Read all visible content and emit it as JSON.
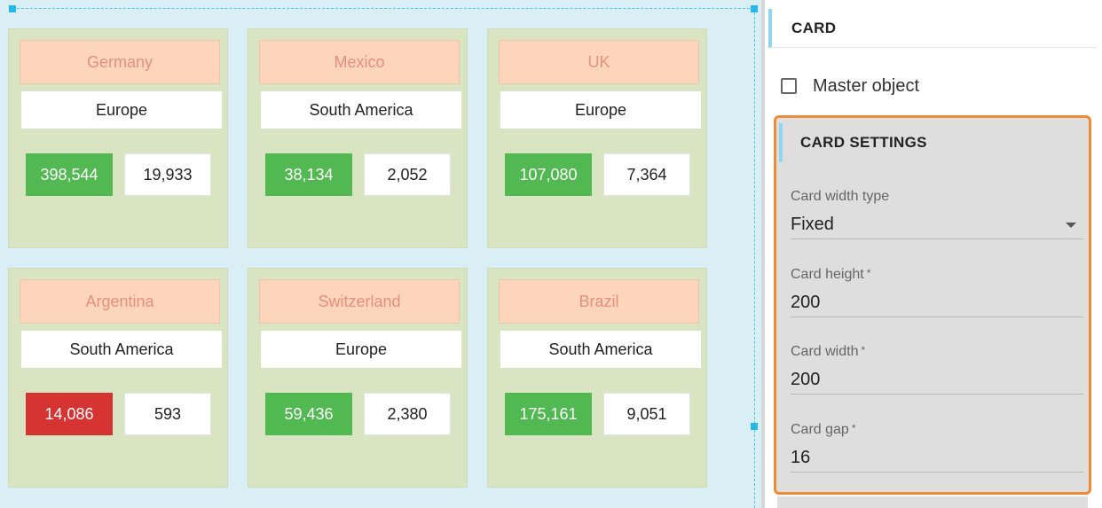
{
  "cards": [
    {
      "country": "Germany",
      "region": "Europe",
      "primary": "398,544",
      "secondary": "19,933",
      "primary_color": "#52b852"
    },
    {
      "country": "Mexico",
      "region": "South America",
      "primary": "38,134",
      "secondary": "2,052",
      "primary_color": "#52b852"
    },
    {
      "country": "UK",
      "region": "Europe",
      "primary": "107,080",
      "secondary": "7,364",
      "primary_color": "#52b852"
    },
    {
      "country": "Argentina",
      "region": "South America",
      "primary": "14,086",
      "secondary": "593",
      "primary_color": "#d63333"
    },
    {
      "country": "Switzerland",
      "region": "Europe",
      "primary": "59,436",
      "secondary": "2,380",
      "primary_color": "#52b852"
    },
    {
      "country": "Brazil",
      "region": "South America",
      "primary": "175,161",
      "secondary": "9,051",
      "primary_color": "#52b852"
    }
  ],
  "panel": {
    "title": "CARD",
    "master_label": "Master object",
    "master_checked": false,
    "settings_title": "CARD SETTINGS",
    "width_type_label": "Card width type",
    "width_type_value": "Fixed",
    "height_label": "Card height",
    "height_value": "200",
    "width_label": "Card width",
    "width_value": "200",
    "gap_label": "Card gap",
    "gap_value": "16",
    "required_mark": "*"
  },
  "colors": {
    "card_bg": "#d8e4c2",
    "country_bg": "#fdd5bb",
    "country_text": "#e58f7f",
    "highlight_border": "#ee8b37",
    "selection": "#29b6e8"
  }
}
